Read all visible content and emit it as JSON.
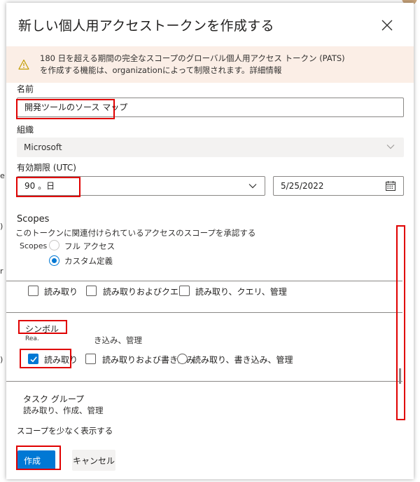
{
  "dialog": {
    "title": "新しい個人用アクセストークンを作成する",
    "close_icon": "close-icon"
  },
  "warning": {
    "icon": "warning-icon",
    "line1": "180 日を超える期間の完全なスコープのグローバル個人用アクセス トークン (PATS)",
    "line2_prefix": "を作成する機能は、organizationによって制限されます。",
    "link": "詳細情報"
  },
  "form": {
    "name_label": "名前",
    "name_value": "開発ツールのソース マップ",
    "org_label": "組織",
    "org_value": "Microsoft",
    "expiry_label": "有効期限 (UTC)",
    "expiry_value": "90 。日",
    "date_value": "5/25/2022",
    "calendar_icon": "calendar-icon"
  },
  "scopes": {
    "title": "Scopes",
    "description": "このトークンに関連付けられているアクセスのスコープを承認する",
    "scopes_label": "Scopes",
    "full_access": "フル アクセス",
    "custom": "カスタム定義",
    "row1": {
      "read": "読み取り",
      "read_query": "読み取りおよびクエリ",
      "read_query_manage": "読み取り、クエリ、管理"
    },
    "symbol": {
      "title": "シンボル",
      "desc_partial": "Rea.",
      "desc_rest": "き込み、管理",
      "read": "読み取り",
      "read_write": "読み取りおよび書き込み",
      "read_write_manage": "読み取り、書き込み、管理"
    },
    "task_group": {
      "title": "タスク グループ",
      "desc": "読み取り、作成、管理"
    },
    "show_less": "スコープを少なく表示する"
  },
  "actions": {
    "create": "作成",
    "cancel": "キャンセル"
  },
  "colors": {
    "accent": "#0078d4",
    "highlight": "#e00000",
    "warning_bg": "#fbeee6",
    "warning_icon": "#c19c00"
  }
}
